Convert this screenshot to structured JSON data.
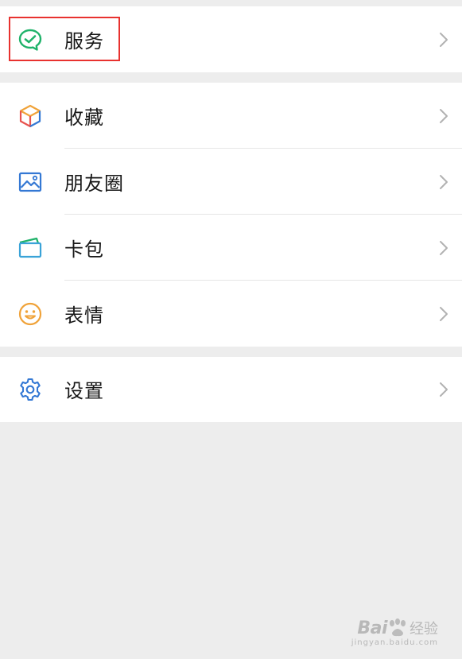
{
  "menu": {
    "groups": [
      {
        "items": [
          {
            "label": "服务",
            "icon": "wechat-pay-icon",
            "highlighted": true
          }
        ]
      },
      {
        "items": [
          {
            "label": "收藏",
            "icon": "favorites-cube-icon"
          },
          {
            "label": "朋友圈",
            "icon": "moments-image-icon"
          },
          {
            "label": "卡包",
            "icon": "card-wallet-icon"
          },
          {
            "label": "表情",
            "icon": "smiley-face-icon"
          }
        ]
      },
      {
        "items": [
          {
            "label": "设置",
            "icon": "gear-icon"
          }
        ]
      }
    ]
  },
  "watermark": {
    "brand": "Bai",
    "sub": "经验",
    "url": "jingyan.baidu.com"
  },
  "colors": {
    "background": "#ededed",
    "row": "#ffffff",
    "highlight": "#e8322f",
    "services_green": "#1fb26a",
    "blue": "#3478d4",
    "orange": "#f0a33a"
  }
}
